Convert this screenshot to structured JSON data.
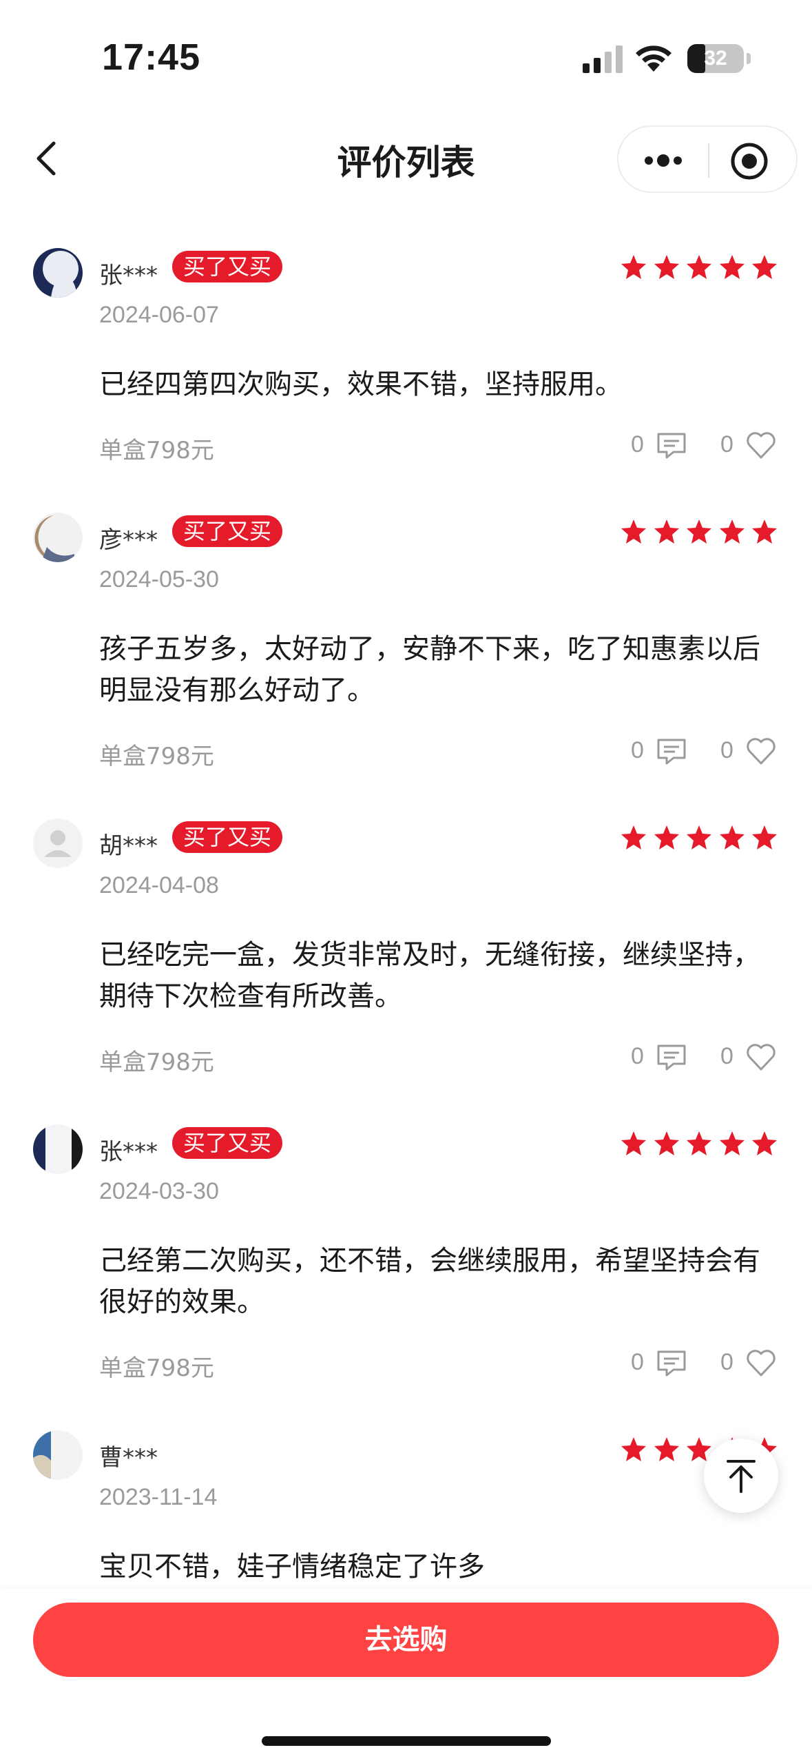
{
  "status_bar": {
    "time": "17:45",
    "battery": "32",
    "battery_level": 0.32
  },
  "nav": {
    "title": "评价列表"
  },
  "reviews": [
    {
      "user": "张***",
      "tag": "买了又买",
      "rating": 5,
      "date": "2024-06-07",
      "text": "已经四第四次购买，效果不错，坚持服用。",
      "spec": "单盒798元",
      "comments": "0",
      "likes": "0"
    },
    {
      "user": "彦***",
      "tag": "买了又买",
      "rating": 5,
      "date": "2024-05-30",
      "text": "孩子五岁多，太好动了，安静不下来，吃了知惠素以后明显没有那么好动了。",
      "spec": "单盒798元",
      "comments": "0",
      "likes": "0"
    },
    {
      "user": "胡***",
      "tag": "买了又买",
      "rating": 5,
      "date": "2024-04-08",
      "text": "已经吃完一盒，发货非常及时，无缝衔接，继续坚持，期待下次检查有所改善。",
      "spec": "单盒798元",
      "comments": "0",
      "likes": "0"
    },
    {
      "user": "张***",
      "tag": "买了又买",
      "rating": 5,
      "date": "2024-03-30",
      "text": "己经第二次购买，还不错，会继续服用，希望坚持会有很好的效果。",
      "spec": "单盒798元",
      "comments": "0",
      "likes": "0"
    },
    {
      "user": "曹***",
      "tag": "",
      "rating": 5,
      "date": "2023-11-14",
      "text": "宝贝不错，娃子情绪稳定了许多",
      "spec": "",
      "comments": "",
      "likes": ""
    }
  ],
  "bottom": {
    "buy_label": "去选购"
  },
  "colors": {
    "accent": "#e51b2b",
    "buy_button": "#ff4242",
    "muted_text": "#9a9a9a"
  }
}
